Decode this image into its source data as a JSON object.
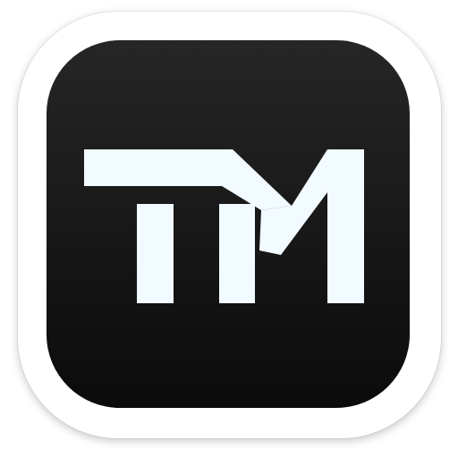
{
  "app_icon": {
    "logo_text": "TM",
    "colors": {
      "outer_plate": "#ffffff",
      "tile_top": "#262626",
      "tile_bottom": "#0b0b0b",
      "glyph": "#f2fbff"
    }
  }
}
